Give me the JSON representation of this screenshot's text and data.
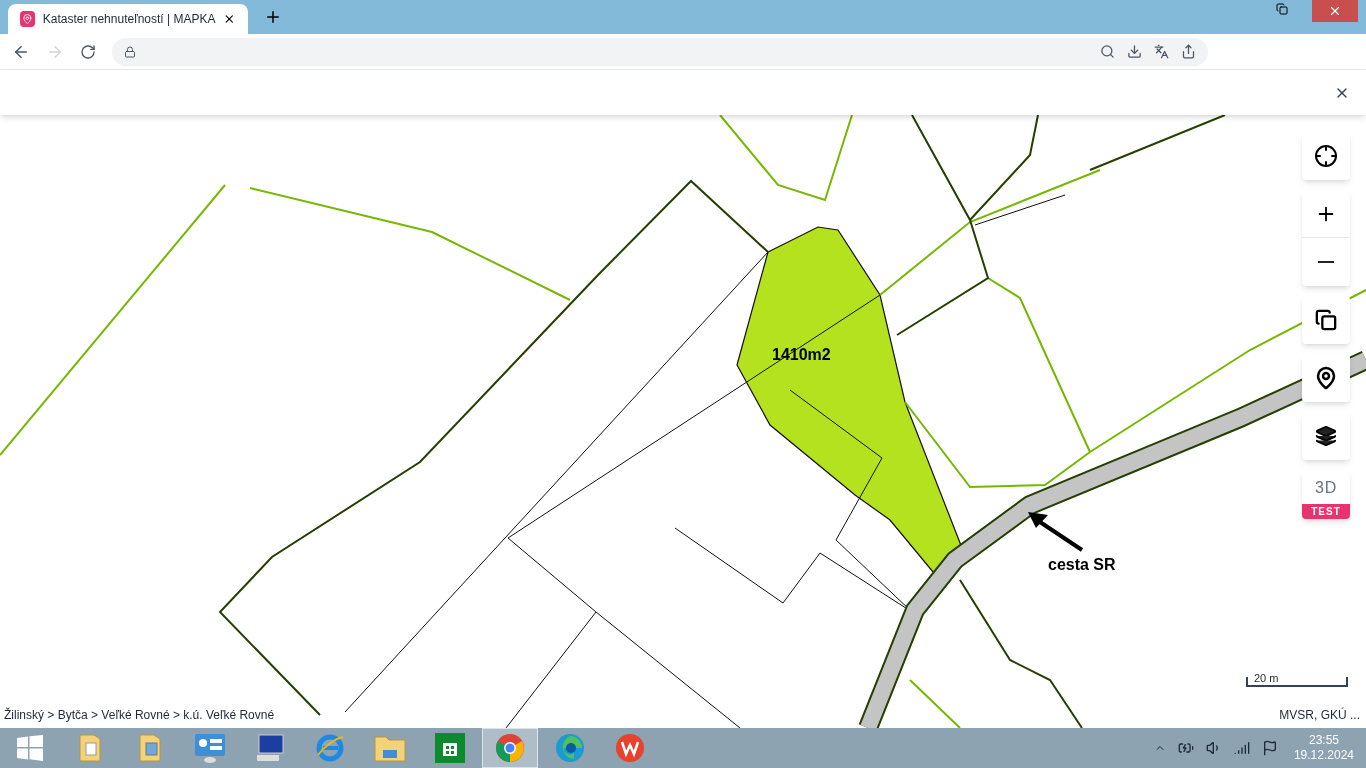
{
  "browser": {
    "tab": {
      "title": "Kataster nehnuteľností | MAPKA",
      "selected": true
    },
    "forward_disabled": true
  },
  "map": {
    "labels": [
      {
        "kind": "area",
        "text": "1410m2"
      },
      {
        "kind": "annotation",
        "text": "cesta SR"
      }
    ],
    "controls": [
      {
        "kind": "locate"
      },
      {
        "kind": "zoom"
      },
      {
        "kind": "compare"
      },
      {
        "kind": "gmaps"
      },
      {
        "kind": "layers"
      },
      {
        "kind": "threed",
        "label": "3D",
        "badge": "TEST"
      }
    ],
    "breadcrumb": "Žilinský > Bytča > Veľké Rovné > k.ú. Veľké Rovné",
    "scale": "20 m",
    "attribution": "MVSR, GKÚ ..."
  },
  "taskbar": {
    "apps": [
      {
        "kind": "start",
        "selected": false
      },
      {
        "kind": "folder",
        "selected": false
      },
      {
        "kind": "pictures",
        "selected": false
      },
      {
        "kind": "control",
        "selected": false
      },
      {
        "kind": "computer",
        "selected": false
      },
      {
        "kind": "ie",
        "selected": false
      },
      {
        "kind": "explorer",
        "selected": false
      },
      {
        "kind": "store",
        "selected": false
      },
      {
        "kind": "chrome",
        "selected": true
      },
      {
        "kind": "edge",
        "selected": false
      },
      {
        "kind": "wps",
        "selected": false
      }
    ],
    "time": "23:55",
    "date": "19.12.2024"
  }
}
